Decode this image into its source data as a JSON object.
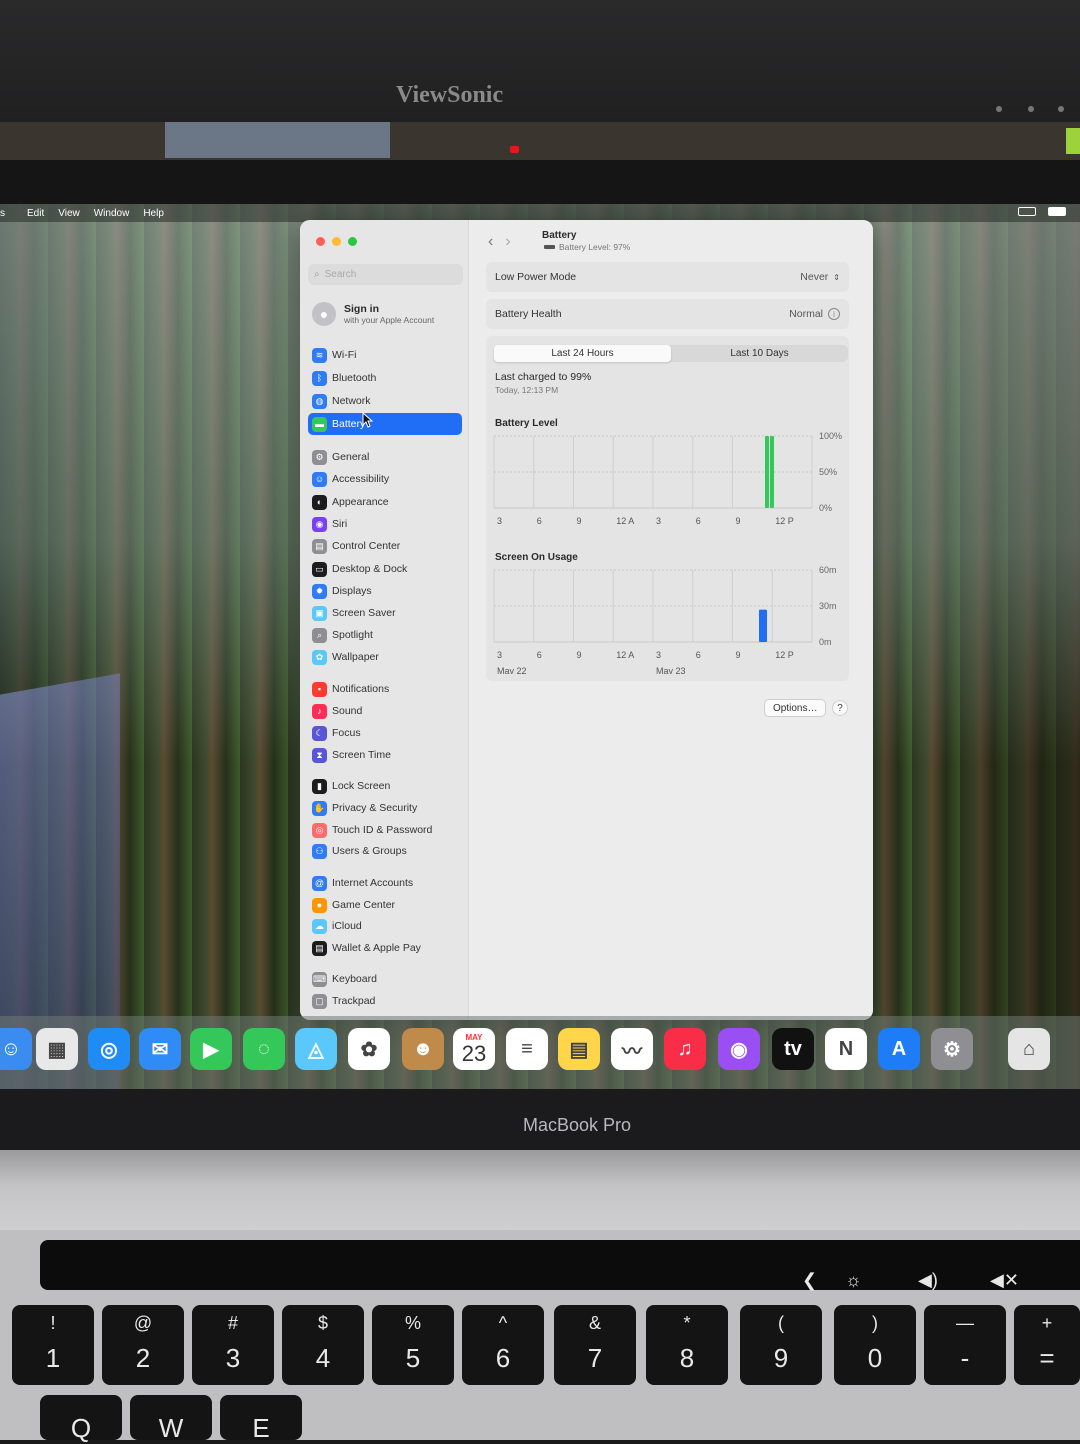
{
  "monitor": {
    "brand": "ViewSonic"
  },
  "menubar": {
    "items": [
      "s",
      "Edit",
      "View",
      "Window",
      "Help"
    ]
  },
  "sidebar": {
    "search_placeholder": "Search",
    "account": {
      "title": "Sign in",
      "subtitle": "with your Apple Account"
    },
    "items": [
      {
        "label": "Wi-Fi",
        "icon": "wifi-icon",
        "color": "#2f7cf6",
        "glyph": "≋"
      },
      {
        "label": "Bluetooth",
        "icon": "bluetooth-icon",
        "color": "#2f7cf6",
        "glyph": "ᛒ"
      },
      {
        "label": "Network",
        "icon": "globe-icon",
        "color": "#2f7cf6",
        "glyph": "◍"
      },
      {
        "label": "Battery",
        "icon": "battery-icon",
        "color": "#34c759",
        "glyph": "▬",
        "selected": true
      },
      {
        "label": "General",
        "icon": "gear-icon",
        "color": "#8e8e93",
        "glyph": "⚙"
      },
      {
        "label": "Accessibility",
        "icon": "accessibility-icon",
        "color": "#2f7cf6",
        "glyph": "☺"
      },
      {
        "label": "Appearance",
        "icon": "appearance-icon",
        "color": "#1c1c1e",
        "glyph": "◐"
      },
      {
        "label": "Siri",
        "icon": "siri-icon",
        "color": "#7a3ff2",
        "glyph": "◉"
      },
      {
        "label": "Control Center",
        "icon": "control-center-icon",
        "color": "#8e8e93",
        "glyph": "▤"
      },
      {
        "label": "Desktop & Dock",
        "icon": "dock-icon",
        "color": "#1c1c1e",
        "glyph": "▭"
      },
      {
        "label": "Displays",
        "icon": "displays-icon",
        "color": "#2f7cf6",
        "glyph": "✹"
      },
      {
        "label": "Screen Saver",
        "icon": "screen-saver-icon",
        "color": "#5ac8fa",
        "glyph": "▣"
      },
      {
        "label": "Spotlight",
        "icon": "spotlight-icon",
        "color": "#8e8e93",
        "glyph": "⌕"
      },
      {
        "label": "Wallpaper",
        "icon": "wallpaper-icon",
        "color": "#5ac8fa",
        "glyph": "✿"
      },
      {
        "label": "Notifications",
        "icon": "notifications-icon",
        "color": "#ff3b30",
        "glyph": "▪"
      },
      {
        "label": "Sound",
        "icon": "sound-icon",
        "color": "#ff2d55",
        "glyph": "♪"
      },
      {
        "label": "Focus",
        "icon": "focus-icon",
        "color": "#5856d6",
        "glyph": "☾"
      },
      {
        "label": "Screen Time",
        "icon": "screen-time-icon",
        "color": "#5856d6",
        "glyph": "⧗"
      },
      {
        "label": "Lock Screen",
        "icon": "lock-icon",
        "color": "#1c1c1e",
        "glyph": "▮"
      },
      {
        "label": "Privacy & Security",
        "icon": "privacy-icon",
        "color": "#2f7cf6",
        "glyph": "✋"
      },
      {
        "label": "Touch ID & Password",
        "icon": "fingerprint-icon",
        "color": "#ff6b6b",
        "glyph": "◎"
      },
      {
        "label": "Users & Groups",
        "icon": "users-icon",
        "color": "#2f7cf6",
        "glyph": "⚇"
      },
      {
        "label": "Internet Accounts",
        "icon": "at-icon",
        "color": "#2f7cf6",
        "glyph": "@"
      },
      {
        "label": "Game Center",
        "icon": "game-center-icon",
        "color": "#ff9500",
        "glyph": "●"
      },
      {
        "label": "iCloud",
        "icon": "cloud-icon",
        "color": "#5ac8fa",
        "glyph": "☁"
      },
      {
        "label": "Wallet & Apple Pay",
        "icon": "wallet-icon",
        "color": "#1c1c1e",
        "glyph": "▤"
      },
      {
        "label": "Keyboard",
        "icon": "keyboard-icon",
        "color": "#8e8e93",
        "glyph": "⌨"
      },
      {
        "label": "Trackpad",
        "icon": "trackpad-icon",
        "color": "#8e8e93",
        "glyph": "▢"
      }
    ]
  },
  "header": {
    "title": "Battery",
    "subtitle": "Battery Level: 97%"
  },
  "settings": {
    "low_power_label": "Low Power Mode",
    "low_power_value": "Never",
    "health_label": "Battery Health",
    "health_value": "Normal"
  },
  "tabs": {
    "tab_24h": "Last 24 Hours",
    "tab_10d": "Last 10 Days",
    "active": "Last 24 Hours"
  },
  "last_charged": {
    "text": "Last charged to 99%",
    "time": "Today, 12:13 PM"
  },
  "buttons": {
    "options": "Options…",
    "help": "?"
  },
  "chart_data": [
    {
      "type": "bar",
      "title": "Battery Level",
      "x_ticks": [
        "3",
        "6",
        "9",
        "12 A",
        "3",
        "6",
        "9",
        "12 P"
      ],
      "y_ticks": [
        "100%",
        "50%",
        "0%"
      ],
      "ylim": [
        0,
        100
      ],
      "values": [
        100,
        100
      ],
      "color": "#34c759",
      "grid": true
    },
    {
      "type": "bar",
      "title": "Screen On Usage",
      "x_ticks": [
        "3",
        "6",
        "9",
        "12 A",
        "3",
        "6",
        "9",
        "12 P"
      ],
      "date_labels": [
        "May 22",
        "May 23"
      ],
      "y_ticks": [
        "60m",
        "30m",
        "0m"
      ],
      "ylim": [
        0,
        60
      ],
      "values": [
        27
      ],
      "color": "#1f6ef5",
      "grid": true
    }
  ],
  "dock": {
    "apps": [
      {
        "name": "finder-icon",
        "color": "#3b8cf0",
        "glyph": "☺"
      },
      {
        "name": "launchpad-icon",
        "color": "#e8e8e8",
        "glyph": "▦"
      },
      {
        "name": "safari-icon",
        "color": "#1f8cf5",
        "glyph": "◎"
      },
      {
        "name": "mail-icon",
        "color": "#2f8cf6",
        "glyph": "✉"
      },
      {
        "name": "facetime-icon",
        "color": "#34c759",
        "glyph": "▶"
      },
      {
        "name": "messages-icon",
        "color": "#34c759",
        "glyph": "◌"
      },
      {
        "name": "maps-icon",
        "color": "#5ac8fa",
        "glyph": "◬"
      },
      {
        "name": "photos-icon",
        "color": "#ffffff",
        "glyph": "✿"
      },
      {
        "name": "contacts-icon",
        "color": "#c08a4a",
        "glyph": "☻"
      },
      {
        "name": "calendar-icon",
        "color": "#ffffff",
        "glyph": "23",
        "month": "MAY",
        "day": "23"
      },
      {
        "name": "reminders-icon",
        "color": "#ffffff",
        "glyph": "≡"
      },
      {
        "name": "notes-icon",
        "color": "#ffd54a",
        "glyph": "▤"
      },
      {
        "name": "freeform-icon",
        "color": "#ffffff",
        "glyph": "〰"
      },
      {
        "name": "music-icon",
        "color": "#fa2d48",
        "glyph": "♫"
      },
      {
        "name": "podcasts-icon",
        "color": "#9a4ff2",
        "glyph": "◉"
      },
      {
        "name": "tv-icon",
        "color": "#111111",
        "glyph": "tv"
      },
      {
        "name": "news-icon",
        "color": "#ffffff",
        "glyph": "N"
      },
      {
        "name": "app-store-icon",
        "color": "#1e7cf6",
        "glyph": "A"
      },
      {
        "name": "system-settings-icon",
        "color": "#8e8e93",
        "glyph": "⚙"
      },
      {
        "name": "migration-assistant-icon",
        "color": "#e5e5e5",
        "glyph": "⌂"
      }
    ]
  },
  "laptop": {
    "label": "MacBook Pro",
    "keys": [
      {
        "shift": "!",
        "main": "1"
      },
      {
        "shift": "@",
        "main": "2"
      },
      {
        "shift": "#",
        "main": "3"
      },
      {
        "shift": "$",
        "main": "4"
      },
      {
        "shift": "%",
        "main": "5"
      },
      {
        "shift": "^",
        "main": "6"
      },
      {
        "shift": "&",
        "main": "7"
      },
      {
        "shift": "*",
        "main": "8"
      },
      {
        "shift": "(",
        "main": "9"
      },
      {
        "shift": ")",
        "main": "0"
      },
      {
        "shift": "—",
        "main": "-"
      },
      {
        "shift": "+",
        "main": "="
      }
    ],
    "bottom_keys": [
      "Q",
      "W",
      "E"
    ]
  }
}
